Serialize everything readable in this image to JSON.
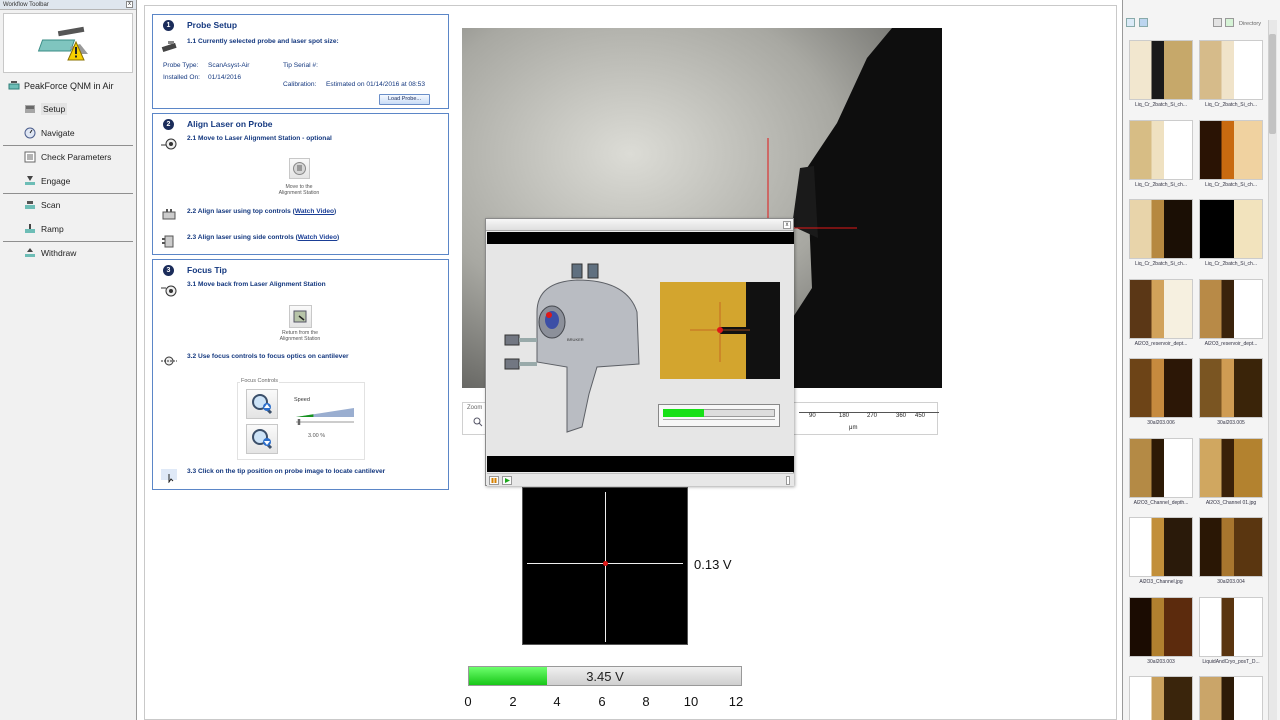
{
  "workflow": {
    "title": "Workflow Toolbar",
    "close_label": "x",
    "mode": "PeakForce QNM in Air",
    "items": [
      {
        "label": "Setup"
      },
      {
        "label": "Navigate"
      },
      {
        "label": "Check Parameters"
      },
      {
        "label": "Engage"
      },
      {
        "label": "Scan"
      },
      {
        "label": "Ramp"
      },
      {
        "label": "Withdraw"
      }
    ]
  },
  "probe_setup": {
    "number": "1",
    "title": "Probe Setup",
    "step1": "1.1 Currently selected probe and laser spot size:",
    "probe_type_label": "Probe Type:",
    "probe_type_value": "ScanAsyst-Air",
    "installed_label": "Installed On:",
    "installed_value": "01/14/2016",
    "tip_serial_label": "Tip Serial #:",
    "tip_serial_value": "",
    "calibration_label": "Calibration:",
    "calibration_value": "Estimated on 01/14/2016 at 08:53",
    "load_probe_label": "Load Probe..."
  },
  "align_laser": {
    "number": "2",
    "title": "Align Laser on Probe",
    "step1": "2.1 Move to Laser Alignment Station - optional",
    "move_caption_1": "Move to the",
    "move_caption_2": "Alignment Station",
    "step2_pre": "2.2 Align laser using top controls (",
    "step2_link": "Watch Video",
    "step2_post": ")",
    "step3_pre": "2.3 Align laser using side controls (",
    "step3_link": "Watch Video",
    "step3_post": ")"
  },
  "focus_tip": {
    "number": "3",
    "title": "Focus Tip",
    "step1": "3.1 Move back from Laser Alignment Station",
    "return_caption_1": "Return from the",
    "return_caption_2": "Alignment Station",
    "step2": "3.2 Use focus controls to focus optics on cantilever",
    "focus_controls_label": "Focus Controls",
    "speed_label": "Speed",
    "speed_value": "3.00 %",
    "speed_fraction": 0.03,
    "step3": "3.3 Click on the tip position on probe image to locate cantilever"
  },
  "zoom": {
    "label": "Zoom",
    "scale_ticks": [
      "90",
      "180",
      "270",
      "360",
      "450"
    ],
    "unit": "μm"
  },
  "popup": {
    "close_label": "x",
    "detector_progress": 0.37,
    "head_brand": "BRUKER",
    "play_icon": "play-icon",
    "pause_icon": "pause-icon"
  },
  "sum_signal": {
    "value_label": "0.13 V"
  },
  "voltage_bar": {
    "value": 3.45,
    "max": 12,
    "text": "3.45  V",
    "ticks": [
      "0",
      "2",
      "4",
      "6",
      "8",
      "10",
      "12"
    ]
  },
  "browser": {
    "directory_label": "Directory",
    "thumbnails": [
      {
        "caption": "Liq_Cr_2batch_Si_ch..."
      },
      {
        "caption": "Liq_Cr_2batch_Si_ch..."
      },
      {
        "caption": "Liq_Cr_2batch_Si_ch..."
      },
      {
        "caption": "Liq_Cr_2batch_Si_ch..."
      },
      {
        "caption": "Liq_Cr_2batch_Si_ch..."
      },
      {
        "caption": "Liq_Cr_2batch_Si_ch..."
      },
      {
        "caption": "Al2O3_reservoir_dept..."
      },
      {
        "caption": "Al2O3_reservoir_dept..."
      },
      {
        "caption": "30al203.006"
      },
      {
        "caption": "30al203.005"
      },
      {
        "caption": "Al2O3_Channel_depth..."
      },
      {
        "caption": "Al2O3_Channel 01.jpg"
      },
      {
        "caption": "Al2O3_Channel.jpg"
      },
      {
        "caption": "30al203.004"
      },
      {
        "caption": "30al203.003"
      },
      {
        "caption": "LiquidAndCryo_posT_D..."
      },
      {
        "caption": ""
      },
      {
        "caption": ""
      }
    ]
  }
}
